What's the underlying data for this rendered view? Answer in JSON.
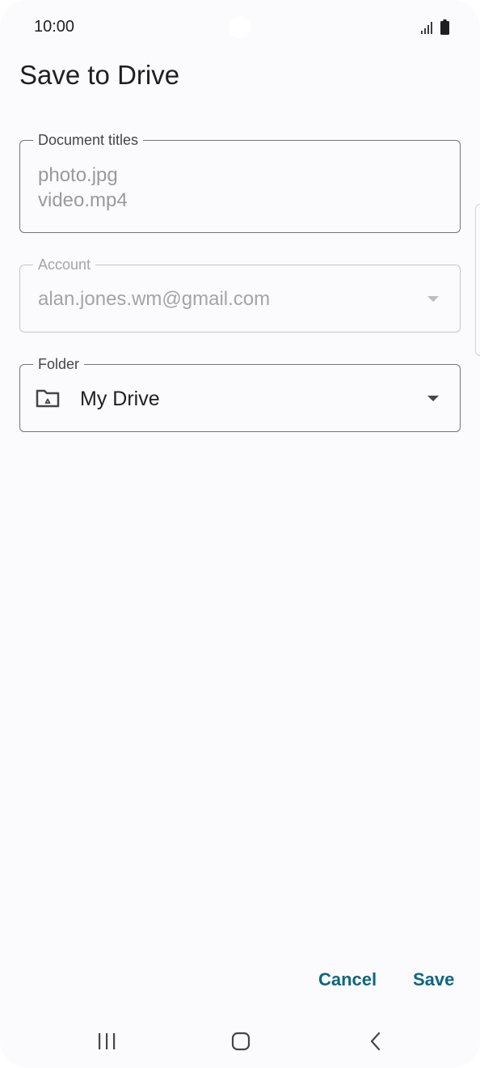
{
  "status_bar": {
    "time": "10:00",
    "icons": [
      "signal-icon",
      "battery-icon"
    ]
  },
  "page": {
    "title": "Save to Drive"
  },
  "document_titles": {
    "label": "Document titles",
    "values": [
      "photo.jpg",
      "video.mp4"
    ]
  },
  "account": {
    "label": "Account",
    "value": "alan.jones.wm@gmail.com",
    "enabled": false
  },
  "folder": {
    "label": "Folder",
    "value": "My Drive",
    "icon": "drive-folder-icon"
  },
  "actions": {
    "cancel_label": "Cancel",
    "save_label": "Save"
  },
  "nav_bar": {
    "icons": [
      "recent-apps-icon",
      "home-icon",
      "back-icon"
    ]
  },
  "colors": {
    "background": "#fbfafd",
    "accent": "#0b6781",
    "outline": "#747775",
    "disabled": "#a4a4a6"
  }
}
